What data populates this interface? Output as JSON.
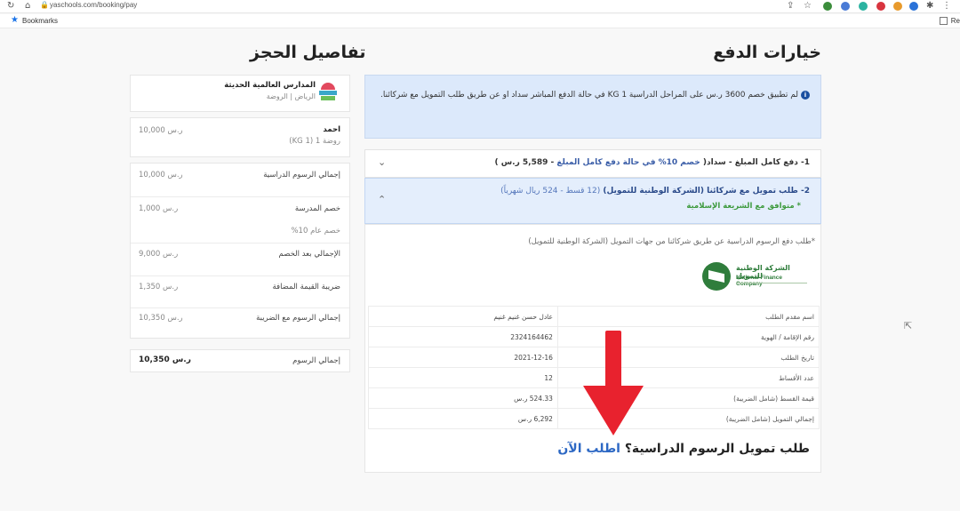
{
  "browser": {
    "url": "yaschools.com/booking/pay",
    "bookmarks_label": "Bookmarks",
    "reading_list_label": "Re"
  },
  "payment": {
    "heading": "خيارات الدفع",
    "info_text": "لم تطبيق خصم 3600 ر.س على المراحل الدراسية KG 1 في حالة الدفع المباشر سداد او عن طريق طلب التمويل مع شركائنا.",
    "option1": {
      "prefix": "1- دفع كامل المبلغ - سداد( ",
      "highlight": "خصم 10% في حالة دفع كامل المبلغ",
      "suffix": " - 5,589 ر.س )"
    },
    "option2": {
      "prefix": "2- طلب تمويل مع شركائنا (الشركة الوطنية للتمويل) ",
      "highlight": "(12 قسط - 524 ريال شهرياً)",
      "sharia": "* متوافق مع الشريعة الإسلامية"
    },
    "note": "*طلب دفع الرسوم الدراسية عن طريق شركائنا من جهات التمويل  (الشركة الوطنية للتمويل)",
    "finance_logo": {
      "arabic": "الشركة الوطنية للتمويل",
      "english": "National Finance Company"
    },
    "request_table": [
      {
        "label": "اسم مقدم الطلب",
        "value": "عادل حسن غنيم غنيم"
      },
      {
        "label": "رقم الإقامة / الهوية",
        "value": "2324164462"
      },
      {
        "label": "تاريخ الطلب",
        "value": "2021-12-16"
      },
      {
        "label": "عدد الأقساط",
        "value": "12"
      },
      {
        "label": "قيمة القسط (شامل الضريبة)",
        "value": "524.33 ر.س"
      },
      {
        "label": "إجمالي التمويل (شامل الضريبة)",
        "value": "6,292 ر.س"
      }
    ],
    "cta_question": "طلب تمويل الرسوم الدراسية؟",
    "cta_link": "اطلب الآن"
  },
  "details": {
    "heading": "تفاصيل الحجز",
    "school_name": "المدارس العالمية الحديثة",
    "school_location": "الرياض | الروضة",
    "student_name": "احمد",
    "student_grade": "روضة 1 (KG 1)",
    "student_fee": "10,000 ر.س",
    "rows": [
      {
        "label": "إجمالي الرسوم الدراسية",
        "value": "10,000 ر.س"
      },
      {
        "label": "خصم المدرسة",
        "value": "1,000 ر.س"
      },
      {
        "label": "خصم عام 10%",
        "value": ""
      },
      {
        "label": "الإجمالي بعد الخصم",
        "value": "9,000 ر.س"
      },
      {
        "label": "ضريبة القيمة المضافة",
        "value": "1,350 ر.س"
      },
      {
        "label": "إجمالي الرسوم مع الضريبة",
        "value": "10,350 ر.س"
      }
    ],
    "total_label": "إجمالي الرسوم",
    "total_value": "10,350 ر.س"
  },
  "colors": {
    "info_bg": "#dce9fb",
    "option_active_bg": "#e4eefc",
    "link": "#2d68c4",
    "sharia_green": "#3d9a3d",
    "arrow_red": "#e8222e"
  }
}
